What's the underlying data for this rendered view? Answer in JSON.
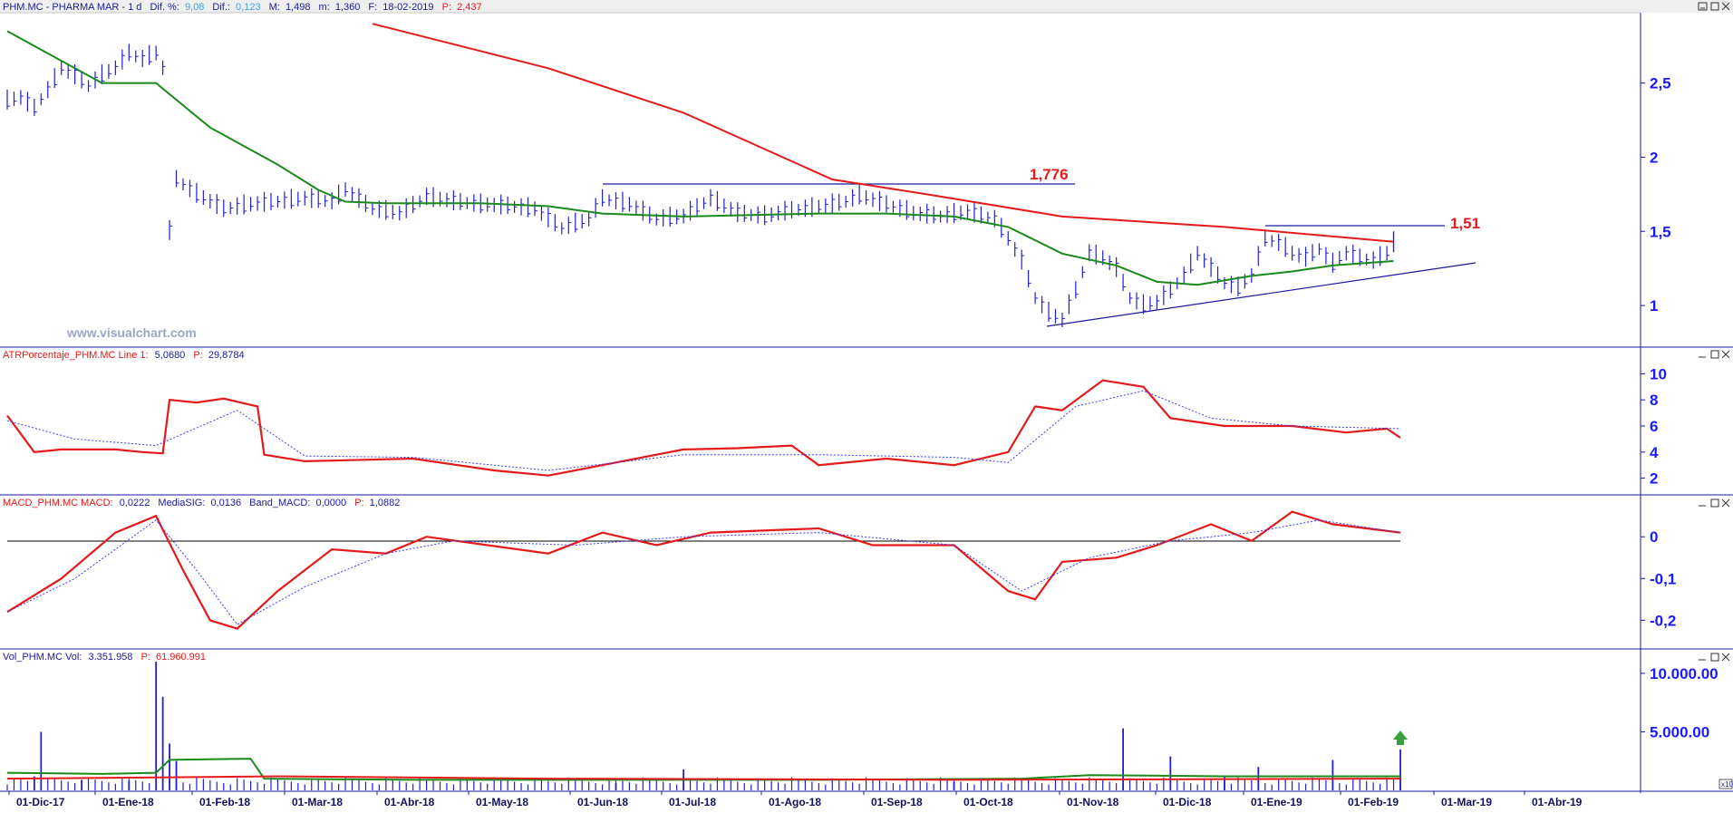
{
  "colors": {
    "price_bar": "#1f1fd6",
    "ma_long": "#e41a1a",
    "ma_short": "#1a8a1a",
    "signal": "#3a3aff",
    "axis_text": "#1a1aff",
    "header_blue": "#1a1aa0",
    "header_red": "#e41a1a",
    "header_cyan": "#4aa0e0"
  },
  "panels": {
    "price": {
      "header": {
        "symbol": "PHM.MC - PHARMA MAR -  1 d",
        "dif_pct_label": "Dif. %:",
        "dif_pct": "9,08",
        "dif_label": "Dif.:",
        "dif": "0,123",
        "high_label": "M:",
        "high": "1,498",
        "low_label": "m:",
        "low": "1,360",
        "date_label": "F:",
        "date": "18-02-2019",
        "p_label": "P:",
        "p": "2,437"
      },
      "watermark": "www.visualchart.com",
      "annotations": [
        "1,776",
        "1,51"
      ]
    },
    "atr": {
      "header": {
        "name": "ATRPorcentaje_PHM.MC  Line 1:",
        "line1": "5,0680",
        "p_label": "P:",
        "p": "29,8784"
      }
    },
    "macd": {
      "header": {
        "name": "MACD_PHM.MC  MACD:",
        "macd": "0,0222",
        "sig_label": "MediaSIG:",
        "sig": "0,0136",
        "band_label": "Band_MACD:",
        "band": "0,0000",
        "p_label": "P:",
        "p": "1,0882"
      }
    },
    "vol": {
      "header": {
        "name": "Vol_PHM.MC  Vol:",
        "vol": "3.351.958",
        "p_label": "P:",
        "p": "61.960.991"
      },
      "scale_badge": "x10"
    }
  },
  "x_labels": [
    "01-Dic-17",
    "01-Ene-18",
    "01-Feb-18",
    "01-Mar-18",
    "01-Abr-18",
    "01-May-18",
    "01-Jun-18",
    "01-Jul-18",
    "01-Ago-18",
    "01-Sep-18",
    "01-Oct-18",
    "01-Nov-18",
    "01-Dic-18",
    "01-Ene-19",
    "01-Feb-19",
    "01-Mar-19",
    "01-Abr-19"
  ],
  "chart_data": [
    {
      "type": "line",
      "panel": "price",
      "y_ticks": [
        "2,5",
        "2",
        "1,5",
        "1"
      ],
      "ylim": [
        0.75,
        2.95
      ],
      "series": [
        {
          "values": [
            [
              0,
              2.38
            ],
            [
              2,
              2.4
            ],
            [
              4,
              2.33
            ],
            [
              6,
              2.45
            ],
            [
              8,
              2.6
            ],
            [
              10,
              2.55
            ],
            [
              12,
              2.48
            ],
            [
              14,
              2.55
            ],
            [
              16,
              2.6
            ],
            [
              18,
              2.7
            ],
            [
              20,
              2.66
            ],
            [
              22,
              2.7
            ],
            [
              23,
              2.6
            ],
            [
              24,
              1.5
            ],
            [
              25,
              1.85
            ],
            [
              28,
              1.75
            ],
            [
              32,
              1.65
            ],
            [
              36,
              1.68
            ],
            [
              40,
              1.7
            ],
            [
              44,
              1.72
            ],
            [
              48,
              1.7
            ],
            [
              50,
              1.78
            ],
            [
              54,
              1.65
            ],
            [
              58,
              1.62
            ],
            [
              62,
              1.73
            ],
            [
              66,
              1.7
            ],
            [
              70,
              1.68
            ],
            [
              74,
              1.67
            ],
            [
              78,
              1.65
            ],
            [
              82,
              1.52
            ],
            [
              86,
              1.58
            ],
            [
              88,
              1.72
            ],
            [
              92,
              1.68
            ],
            [
              96,
              1.58
            ],
            [
              100,
              1.6
            ],
            [
              104,
              1.72
            ],
            [
              108,
              1.62
            ],
            [
              112,
              1.6
            ],
            [
              116,
              1.64
            ],
            [
              120,
              1.66
            ],
            [
              124,
              1.7
            ],
            [
              126,
              1.74
            ],
            [
              130,
              1.68
            ],
            [
              134,
              1.62
            ],
            [
              138,
              1.6
            ],
            [
              142,
              1.63
            ],
            [
              146,
              1.58
            ],
            [
              148,
              1.45
            ],
            [
              150,
              1.3
            ],
            [
              152,
              1.05
            ],
            [
              154,
              0.95
            ],
            [
              156,
              0.9
            ],
            [
              158,
              1.1
            ],
            [
              160,
              1.35
            ],
            [
              162,
              1.32
            ],
            [
              164,
              1.25
            ],
            [
              166,
              1.05
            ],
            [
              168,
              1.0
            ],
            [
              170,
              1.02
            ],
            [
              172,
              1.1
            ],
            [
              174,
              1.2
            ],
            [
              176,
              1.35
            ],
            [
              178,
              1.25
            ],
            [
              180,
              1.15
            ],
            [
              182,
              1.12
            ],
            [
              184,
              1.2
            ],
            [
              186,
              1.45
            ],
            [
              188,
              1.42
            ],
            [
              190,
              1.35
            ],
            [
              192,
              1.32
            ],
            [
              194,
              1.38
            ],
            [
              196,
              1.28
            ],
            [
              198,
              1.35
            ],
            [
              200,
              1.32
            ],
            [
              202,
              1.3
            ],
            [
              204,
              1.35
            ],
            [
              205,
              1.49
            ]
          ]
        },
        {
          "values": [
            [
              54,
              2.9
            ],
            [
              80,
              2.6
            ],
            [
              100,
              2.3
            ],
            [
              122,
              1.85
            ],
            [
              136,
              1.75
            ],
            [
              156,
              1.6
            ],
            [
              180,
              1.53
            ],
            [
              205,
              1.43
            ]
          ]
        },
        {
          "values": [
            [
              0,
              2.85
            ],
            [
              10,
              2.6
            ],
            [
              14,
              2.5
            ],
            [
              22,
              2.5
            ],
            [
              30,
              2.2
            ],
            [
              40,
              1.95
            ],
            [
              46,
              1.78
            ],
            [
              50,
              1.7
            ],
            [
              56,
              1.69
            ],
            [
              70,
              1.69
            ],
            [
              80,
              1.67
            ],
            [
              88,
              1.62
            ],
            [
              100,
              1.6
            ],
            [
              120,
              1.62
            ],
            [
              130,
              1.62
            ],
            [
              140,
              1.6
            ],
            [
              148,
              1.53
            ],
            [
              156,
              1.35
            ],
            [
              164,
              1.27
            ],
            [
              170,
              1.16
            ],
            [
              176,
              1.14
            ],
            [
              184,
              1.2
            ],
            [
              190,
              1.23
            ],
            [
              196,
              1.27
            ],
            [
              205,
              1.3
            ]
          ]
        }
      ]
    },
    {
      "type": "line",
      "panel": "atr",
      "y_ticks": [
        "10",
        "8",
        "6",
        "4",
        "2"
      ],
      "ylim": [
        1,
        11
      ],
      "series": [
        {
          "values": [
            [
              0,
              6.8
            ],
            [
              4,
              4
            ],
            [
              8,
              4.2
            ],
            [
              16,
              4.2
            ],
            [
              20,
              4
            ],
            [
              23,
              3.9
            ],
            [
              24,
              8
            ],
            [
              28,
              7.8
            ],
            [
              32,
              8.1
            ],
            [
              37,
              7.5
            ],
            [
              38,
              3.8
            ],
            [
              44,
              3.3
            ],
            [
              60,
              3.5
            ],
            [
              72,
              2.6
            ],
            [
              80,
              2.2
            ],
            [
              90,
              3.2
            ],
            [
              100,
              4.2
            ],
            [
              108,
              4.3
            ],
            [
              116,
              4.5
            ],
            [
              120,
              3
            ],
            [
              130,
              3.5
            ],
            [
              140,
              3
            ],
            [
              148,
              4
            ],
            [
              152,
              7.5
            ],
            [
              156,
              7.2
            ],
            [
              162,
              9.5
            ],
            [
              168,
              9
            ],
            [
              172,
              6.6
            ],
            [
              180,
              6
            ],
            [
              190,
              6
            ],
            [
              198,
              5.5
            ],
            [
              204,
              5.8
            ],
            [
              206,
              5.1
            ]
          ]
        },
        {
          "values": [
            [
              0,
              6.4
            ],
            [
              10,
              5
            ],
            [
              22,
              4.5
            ],
            [
              34,
              7.2
            ],
            [
              44,
              3.7
            ],
            [
              60,
              3.6
            ],
            [
              80,
              2.6
            ],
            [
              100,
              3.8
            ],
            [
              120,
              3.8
            ],
            [
              140,
              3.6
            ],
            [
              148,
              3.2
            ],
            [
              158,
              7.5
            ],
            [
              168,
              8.7
            ],
            [
              178,
              6.6
            ],
            [
              190,
              6
            ],
            [
              206,
              5.8
            ]
          ]
        }
      ]
    },
    {
      "type": "line",
      "panel": "macd",
      "y_ticks": [
        "0",
        "-0,1",
        "-0,2"
      ],
      "ylim": [
        -0.26,
        0.07
      ],
      "series": [
        {
          "values": [
            [
              0,
              -0.18
            ],
            [
              8,
              -0.1
            ],
            [
              16,
              0.01
            ],
            [
              22,
              0.05
            ],
            [
              26,
              -0.08
            ],
            [
              30,
              -0.2
            ],
            [
              34,
              -0.22
            ],
            [
              40,
              -0.13
            ],
            [
              48,
              -0.03
            ],
            [
              56,
              -0.04
            ],
            [
              62,
              0.0
            ],
            [
              80,
              -0.04
            ],
            [
              88,
              0.01
            ],
            [
              96,
              -0.02
            ],
            [
              104,
              0.01
            ],
            [
              120,
              0.02
            ],
            [
              128,
              -0.02
            ],
            [
              140,
              -0.02
            ],
            [
              148,
              -0.13
            ],
            [
              152,
              -0.15
            ],
            [
              156,
              -0.06
            ],
            [
              164,
              -0.05
            ],
            [
              170,
              -0.02
            ],
            [
              178,
              0.03
            ],
            [
              184,
              -0.01
            ],
            [
              190,
              0.06
            ],
            [
              196,
              0.03
            ],
            [
              206,
              0.01
            ]
          ]
        },
        {
          "values": [
            [
              0,
              -0.18
            ],
            [
              10,
              -0.1
            ],
            [
              22,
              0.04
            ],
            [
              28,
              -0.08
            ],
            [
              34,
              -0.21
            ],
            [
              44,
              -0.12
            ],
            [
              56,
              -0.04
            ],
            [
              66,
              -0.01
            ],
            [
              84,
              -0.02
            ],
            [
              100,
              0.0
            ],
            [
              120,
              0.01
            ],
            [
              140,
              -0.02
            ],
            [
              150,
              -0.13
            ],
            [
              160,
              -0.05
            ],
            [
              172,
              -0.01
            ],
            [
              184,
              0.01
            ],
            [
              194,
              0.04
            ],
            [
              206,
              0.01
            ]
          ]
        }
      ]
    },
    {
      "type": "bar",
      "panel": "vol",
      "y_ticks": [
        "10.000.00",
        "5.000.00"
      ],
      "ylim": [
        0,
        11000
      ],
      "values": [
        [
          4,
          1200
        ],
        [
          5,
          5000
        ],
        [
          11,
          900
        ],
        [
          18,
          800
        ],
        [
          22,
          11000
        ],
        [
          23,
          8000
        ],
        [
          24,
          4000
        ],
        [
          25,
          2500
        ],
        [
          90,
          600
        ],
        [
          100,
          1800
        ],
        [
          140,
          700
        ],
        [
          165,
          5300
        ],
        [
          172,
          2900
        ],
        [
          180,
          1200
        ],
        [
          185,
          2000
        ],
        [
          196,
          2600
        ],
        [
          206,
          3500
        ]
      ],
      "series": [
        {
          "values": [
            [
              0,
              1500
            ],
            [
              14,
              1400
            ],
            [
              22,
              1500
            ],
            [
              24,
              2600
            ],
            [
              36,
              2700
            ],
            [
              38,
              1000
            ],
            [
              60,
              900
            ],
            [
              120,
              900
            ],
            [
              150,
              1000
            ],
            [
              160,
              1300
            ],
            [
              180,
              1200
            ],
            [
              206,
              1200
            ]
          ]
        },
        {
          "values": [
            [
              0,
              1000
            ],
            [
              22,
              1100
            ],
            [
              40,
              1200
            ],
            [
              80,
              1000
            ],
            [
              140,
              900
            ],
            [
              206,
              1000
            ]
          ]
        }
      ]
    }
  ]
}
